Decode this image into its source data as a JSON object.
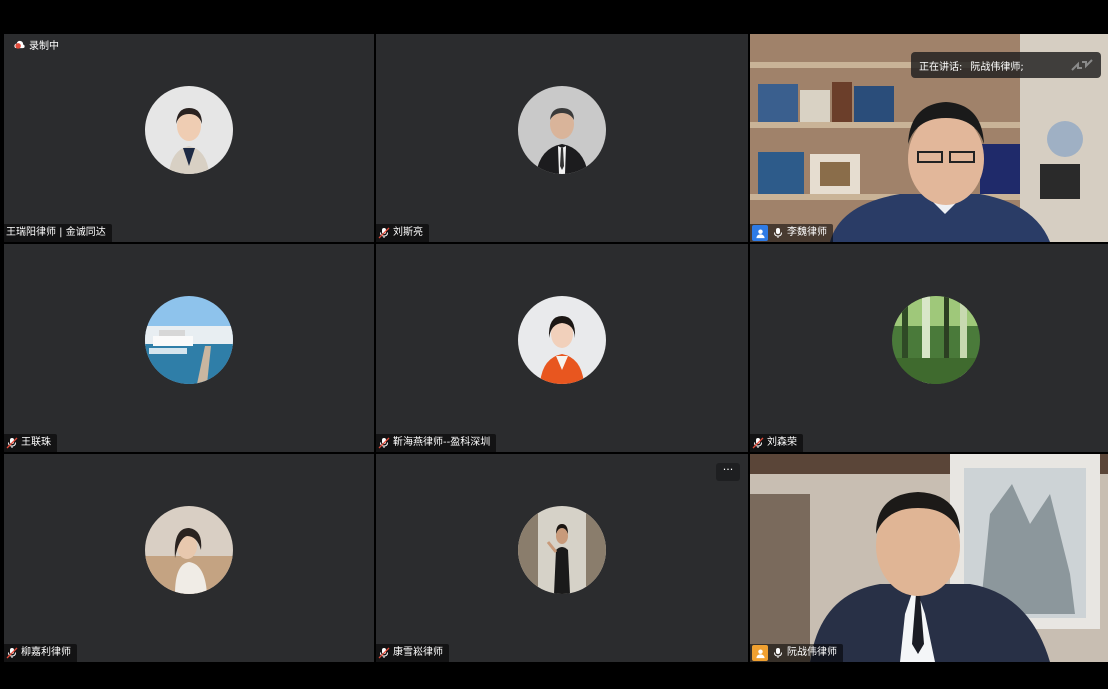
{
  "recording": {
    "label": "录制中",
    "color": "#e24b3b"
  },
  "speaking_banner": {
    "label": "正在讲话:",
    "name": "阮战伟律师;"
  },
  "more_button": {
    "label": "···"
  },
  "participants": [
    {
      "name": "王瑞阳律师 | 金诚同达",
      "type": "avatar",
      "avatar": "woman-portrait",
      "muted": false
    },
    {
      "name": "刘斯亮",
      "type": "avatar",
      "avatar": "man-portrait-suit",
      "muted": true
    },
    {
      "name": "李魏律师",
      "type": "video",
      "video": "man-bookshelf",
      "muted": false,
      "host": true
    },
    {
      "name": "王联珠",
      "type": "avatar",
      "avatar": "harbor-photo",
      "muted": true
    },
    {
      "name": "靳海燕律师--盈科深圳",
      "type": "avatar",
      "avatar": "woman-orange-jacket",
      "muted": true
    },
    {
      "name": "刘森荣",
      "type": "avatar",
      "avatar": "forest-photo",
      "muted": true
    },
    {
      "name": "柳嘉利律师",
      "type": "avatar",
      "avatar": "beach-woman",
      "muted": true
    },
    {
      "name": "康雪崧律师",
      "type": "avatar",
      "avatar": "woman-black-dress",
      "muted": true
    },
    {
      "name": "阮战伟律师",
      "type": "video",
      "video": "man-office",
      "muted": false,
      "host": true,
      "active_speaker": true
    }
  ],
  "colors": {
    "tile_bg": "#2b2c2e",
    "active_border": "#3fbf5a",
    "host_badge": "#2f7be5",
    "host_badge_alt": "#f0a030"
  }
}
